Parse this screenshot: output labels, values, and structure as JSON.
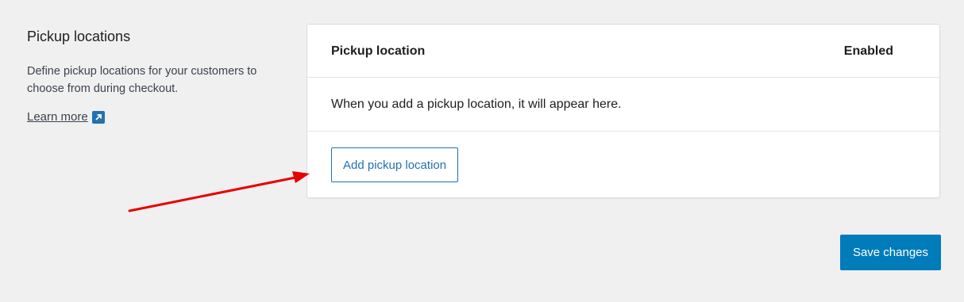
{
  "section": {
    "title": "Pickup locations",
    "description": "Define pickup locations for your customers to choose from during checkout.",
    "learn_more": "Learn more",
    "learn_more_icon": "external-link-icon"
  },
  "table": {
    "headers": [
      "Pickup location",
      "Enabled"
    ],
    "empty_message": "When you add a pickup location, it will appear here.",
    "add_button": "Add pickup location"
  },
  "annotation": {
    "type": "arrow",
    "color": "#e80000",
    "points_to": "add-pickup-location-button"
  },
  "footer": {
    "save_button": "Save changes"
  },
  "colors": {
    "background": "#f0f0f1",
    "accent": "#2271b1",
    "primary_button": "#007cba"
  }
}
